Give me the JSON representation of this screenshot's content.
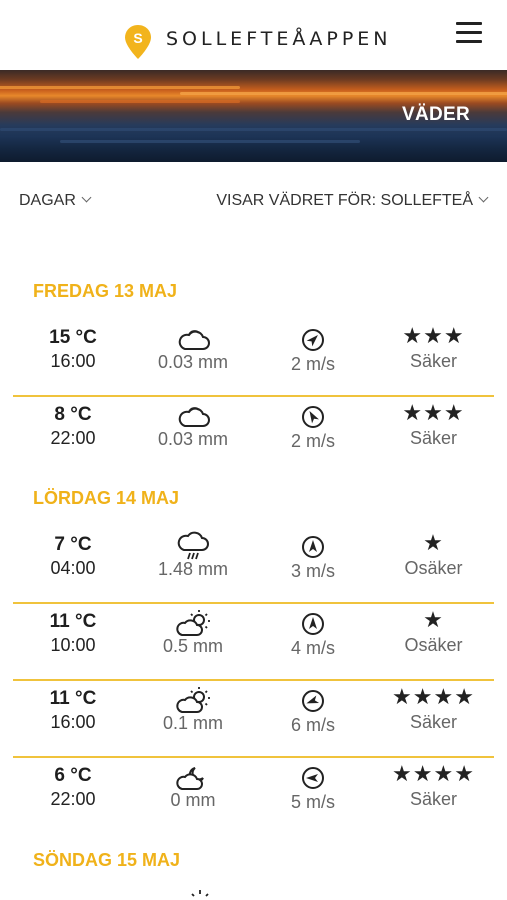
{
  "app": {
    "name": "SOLLEFTEÅAPPEN",
    "logo_letter": "S"
  },
  "hero": {
    "title": "VÄDER"
  },
  "filters": {
    "days_label": "DAGAR",
    "location_label": "VISAR VÄDRET FÖR: SOLLEFTEÅ"
  },
  "colors": {
    "accent": "#f0b21a",
    "separator": "#f0c33c"
  },
  "days": [
    {
      "heading": "FREDAG 13 MAJ",
      "rows": [
        {
          "temp": "15 °C",
          "time": "16:00",
          "precip": "0.03 mm",
          "weather_icon": "cloud-icon",
          "wind": "2 m/s",
          "wind_icon": "wind-direction-icon",
          "wind_dir_deg": 45,
          "stars": "★★★",
          "reliability": "Säker"
        },
        {
          "temp": "8 °C",
          "time": "22:00",
          "precip": "0.03 mm",
          "weather_icon": "cloud-icon",
          "wind": "2 m/s",
          "wind_icon": "wind-direction-icon",
          "wind_dir_deg": -30,
          "stars": "★★★",
          "reliability": "Säker"
        }
      ]
    },
    {
      "heading": "LÖRDAG 14 MAJ",
      "rows": [
        {
          "temp": "7 °C",
          "time": "04:00",
          "precip": "1.48 mm",
          "weather_icon": "rain-cloud-icon",
          "wind": "3 m/s",
          "wind_icon": "wind-direction-icon",
          "wind_dir_deg": 0,
          "stars": "★",
          "reliability": "Osäker"
        },
        {
          "temp": "11 °C",
          "time": "10:00",
          "precip": "0.5 mm",
          "weather_icon": "partly-sunny-icon",
          "wind": "4 m/s",
          "wind_icon": "wind-direction-icon",
          "wind_dir_deg": 0,
          "stars": "★",
          "reliability": "Osäker"
        },
        {
          "temp": "11 °C",
          "time": "16:00",
          "precip": "0.1 mm",
          "weather_icon": "partly-sunny-icon",
          "wind": "6 m/s",
          "wind_icon": "wind-direction-icon",
          "wind_dir_deg": -110,
          "stars": "★★★★",
          "reliability": "Säker"
        },
        {
          "temp": "6 °C",
          "time": "22:00",
          "precip": "0 mm",
          "weather_icon": "partly-cloudy-night-icon",
          "wind": "5 m/s",
          "wind_icon": "wind-direction-icon",
          "wind_dir_deg": -90,
          "stars": "★★★★",
          "reliability": "Säker"
        }
      ]
    },
    {
      "heading": "SÖNDAG 15 MAJ",
      "rows": []
    }
  ]
}
